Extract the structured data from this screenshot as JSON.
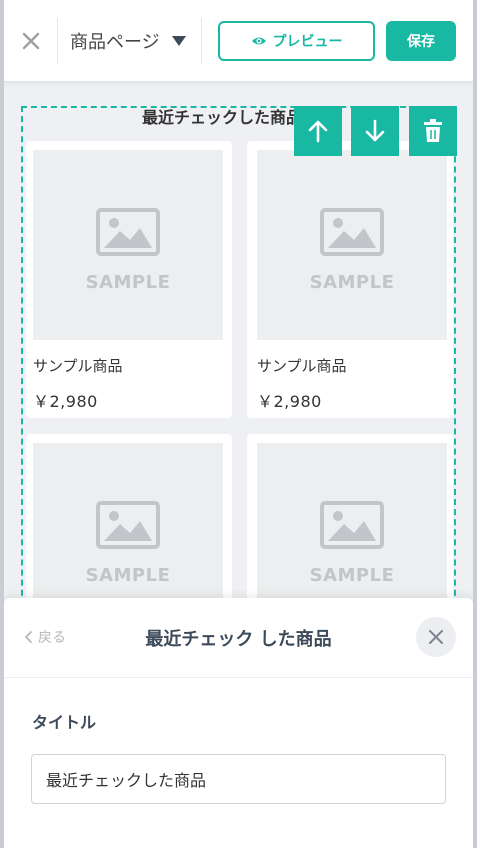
{
  "topbar": {
    "page_selector": "商品ページ",
    "preview_label": "プレビュー",
    "save_label": "保存"
  },
  "section": {
    "title": "最近チェックした商品"
  },
  "products": [
    {
      "image_text": "SAMPLE",
      "name": "サンプル商品",
      "price": "￥2,980"
    },
    {
      "image_text": "SAMPLE",
      "name": "サンプル商品",
      "price": "￥2,980"
    },
    {
      "image_text": "SAMPLE",
      "name": "",
      "price": ""
    },
    {
      "image_text": "SAMPLE",
      "name": "",
      "price": ""
    }
  ],
  "panel": {
    "back_label": "戻る",
    "title": "最近チェック した商品",
    "field_label": "タイトル",
    "field_value": "最近チェックした商品"
  },
  "colors": {
    "accent": "#19b8a3",
    "background": "#eef0f3",
    "placeholder": "#eceeef"
  },
  "icons": [
    "close-icon",
    "caret-down-icon",
    "eye-icon",
    "arrow-up-icon",
    "arrow-down-icon",
    "trash-icon",
    "image-placeholder-icon",
    "chevron-left-icon"
  ]
}
